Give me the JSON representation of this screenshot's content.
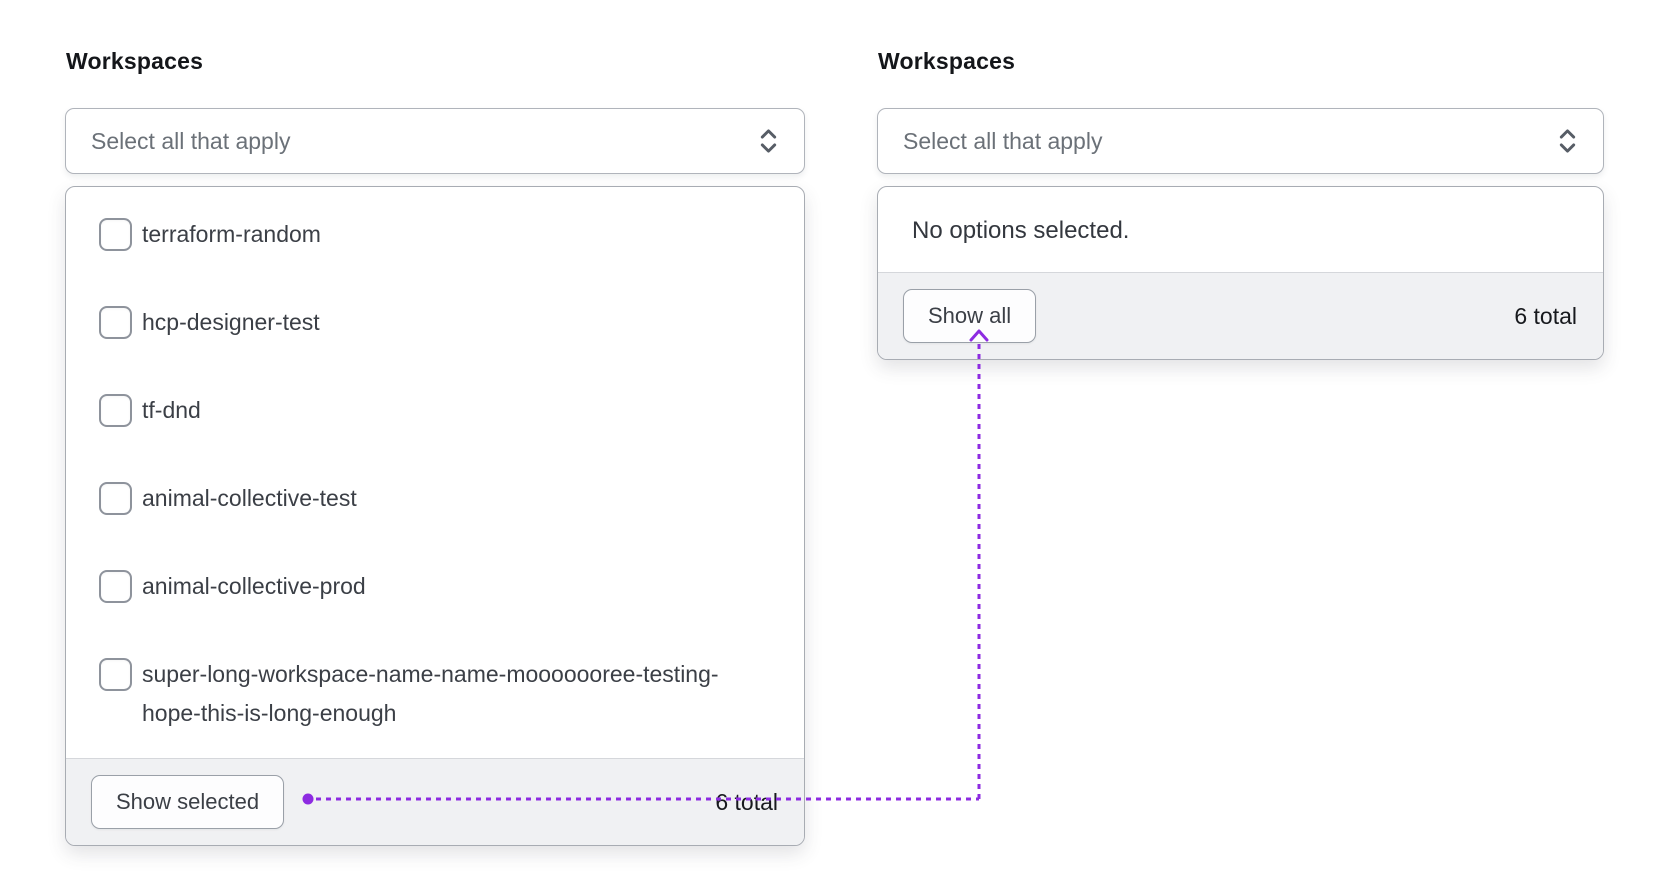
{
  "left_panel": {
    "label": "Workspaces",
    "trigger_placeholder": "Select all that apply",
    "options": [
      {
        "label": "terraform-random",
        "checked": false
      },
      {
        "label": "hcp-designer-test",
        "checked": false
      },
      {
        "label": "tf-dnd",
        "checked": false
      },
      {
        "label": "animal-collective-test",
        "checked": false
      },
      {
        "label": "animal-collective-prod",
        "checked": false
      },
      {
        "label": "super-long-workspace-name-name-mooooooree-testing-hope-this-is-long-enough",
        "checked": false
      }
    ],
    "footer": {
      "button_label": "Show selected",
      "total_label": "6 total"
    }
  },
  "right_panel": {
    "label": "Workspaces",
    "trigger_placeholder": "Select all that apply",
    "empty_message": "No options selected.",
    "footer": {
      "button_label": "Show all",
      "total_label": "6 total"
    }
  },
  "annotation": {
    "color": "#8d2be1"
  }
}
